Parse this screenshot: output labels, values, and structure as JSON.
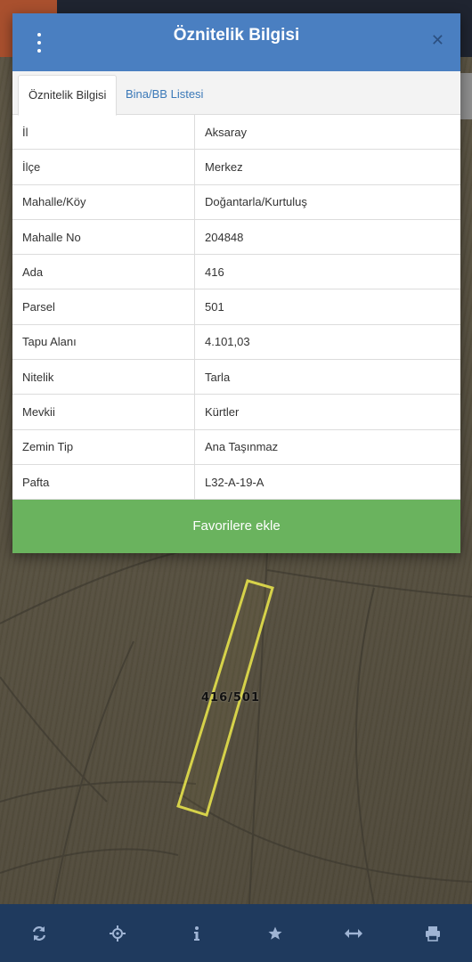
{
  "dialog": {
    "title": "Öznitelik Bilgisi",
    "close_glyph": "✕",
    "tabs": [
      {
        "label": "Öznitelik Bilgisi",
        "active": true
      },
      {
        "label": "Bina/BB Listesi",
        "active": false
      }
    ],
    "rows": [
      {
        "key": "İl",
        "value": "Aksaray"
      },
      {
        "key": "İlçe",
        "value": "Merkez"
      },
      {
        "key": "Mahalle/Köy",
        "value": "Doğantarla/Kurtuluş"
      },
      {
        "key": "Mahalle No",
        "value": "204848"
      },
      {
        "key": "Ada",
        "value": "416"
      },
      {
        "key": "Parsel",
        "value": "501"
      },
      {
        "key": "Tapu Alanı",
        "value": "4.101,03"
      },
      {
        "key": "Nitelik",
        "value": "Tarla"
      },
      {
        "key": "Mevkii",
        "value": "Kürtler"
      },
      {
        "key": "Zemin Tip",
        "value": "Ana Taşınmaz"
      },
      {
        "key": "Pafta",
        "value": "L32-A-19-A"
      }
    ],
    "favorite_button": "Favorilere ekle"
  },
  "map": {
    "parcel_label": "416/501",
    "parcel_outline_color": "#d6d24a"
  },
  "toolbar": {
    "icons": [
      "refresh-icon",
      "locate-icon",
      "info-icon",
      "star-icon",
      "measure-icon",
      "print-icon"
    ]
  },
  "colors": {
    "header": "#4a7fc1",
    "favorite_button": "#6ab35e",
    "toolbar": "#1f3a5e",
    "tab_link": "#3b79b8"
  }
}
